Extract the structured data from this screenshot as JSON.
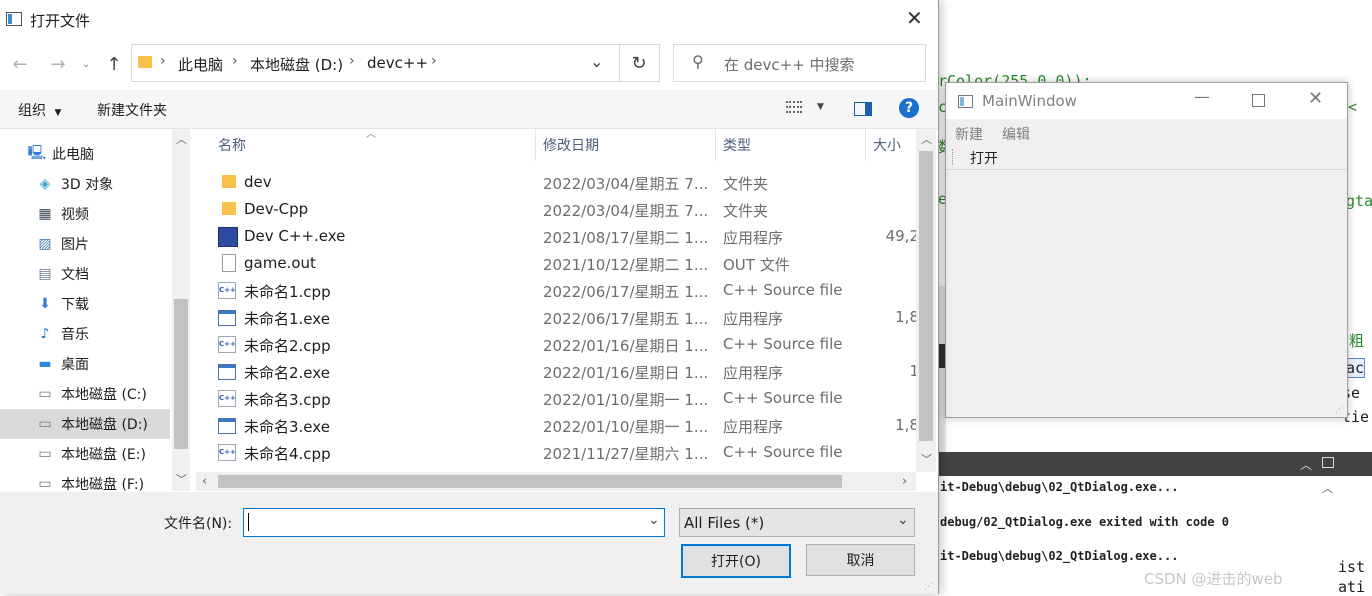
{
  "background": {
    "code_fragments": [
      "rColor(255,0,0));",
      "<",
      "c",
      "数",
      "e",
      "gta",
      "加粗",
      "pac",
      "se",
      "tie",
      "ase",
      "ist",
      "ati"
    ],
    "output_lines": [
      "it-Debug\\debug\\02_QtDialog.exe...",
      "debug/02_QtDialog.exe exited with code 0",
      "it-Debug\\debug\\02_QtDialog.exe..."
    ],
    "watermark": "CSDN @进击的web"
  },
  "main_window": {
    "title": "MainWindow",
    "menu": [
      "新建",
      "编辑"
    ],
    "toolbar_action": "打开"
  },
  "dialog": {
    "title": "打开文件",
    "breadcrumb": [
      "此电脑",
      "本地磁盘 (D:)",
      "devc++"
    ],
    "search_placeholder": "在 devc++ 中搜索",
    "organize_label": "组织",
    "new_folder_label": "新建文件夹",
    "help_glyph": "?",
    "nav_items": [
      {
        "label": "此电脑",
        "icon": "computer-icon"
      },
      {
        "label": "3D 对象",
        "icon": "cube-icon"
      },
      {
        "label": "视频",
        "icon": "video-icon"
      },
      {
        "label": "图片",
        "icon": "picture-icon"
      },
      {
        "label": "文档",
        "icon": "document-icon"
      },
      {
        "label": "下载",
        "icon": "download-icon"
      },
      {
        "label": "音乐",
        "icon": "music-icon"
      },
      {
        "label": "桌面",
        "icon": "desktop-icon"
      },
      {
        "label": "本地磁盘 (C:)",
        "icon": "drive-icon"
      },
      {
        "label": "本地磁盘 (D:)",
        "icon": "drive-icon",
        "selected": true
      },
      {
        "label": "本地磁盘 (E:)",
        "icon": "drive-icon"
      },
      {
        "label": "本地磁盘 (F:)",
        "icon": "drive-icon"
      }
    ],
    "columns": {
      "name": "名称",
      "date": "修改日期",
      "type": "类型",
      "size": "大小"
    },
    "files": [
      {
        "name": "dev",
        "date": "2022/03/04/星期五 7...",
        "type": "文件夹",
        "size": "",
        "icon": "folder-icon"
      },
      {
        "name": "Dev-Cpp",
        "date": "2022/03/04/星期五 7...",
        "type": "文件夹",
        "size": "",
        "icon": "folder-icon"
      },
      {
        "name": "Dev C++.exe",
        "date": "2021/08/17/星期二 1...",
        "type": "应用程序",
        "size": "49,2",
        "icon": "devcpp-app-icon"
      },
      {
        "name": "game.out",
        "date": "2021/10/12/星期二 1...",
        "type": "OUT 文件",
        "size": "",
        "icon": "blank-file-icon"
      },
      {
        "name": "未命名1.cpp",
        "date": "2022/06/17/星期五 1...",
        "type": "C++ Source file",
        "size": "",
        "icon": "cpp-file-icon"
      },
      {
        "name": "未命名1.exe",
        "date": "2022/06/17/星期五 1...",
        "type": "应用程序",
        "size": "1,8",
        "icon": "exe-icon"
      },
      {
        "name": "未命名2.cpp",
        "date": "2022/01/16/星期日 1...",
        "type": "C++ Source file",
        "size": "",
        "icon": "cpp-file-icon"
      },
      {
        "name": "未命名2.exe",
        "date": "2022/01/16/星期日 1...",
        "type": "应用程序",
        "size": "1",
        "icon": "exe-icon"
      },
      {
        "name": "未命名3.cpp",
        "date": "2022/01/10/星期一 1...",
        "type": "C++ Source file",
        "size": "",
        "icon": "cpp-file-icon"
      },
      {
        "name": "未命名3.exe",
        "date": "2022/01/10/星期一 1...",
        "type": "应用程序",
        "size": "1,8",
        "icon": "exe-icon"
      },
      {
        "name": "未命名4.cpp",
        "date": "2021/11/27/星期六 1...",
        "type": "C++ Source file",
        "size": "",
        "icon": "cpp-file-icon"
      }
    ],
    "filename_label": "文件名(N):",
    "filename_value": "",
    "filter_value": "All Files (*)",
    "open_label": "打开(O)",
    "cancel_label": "取消"
  },
  "colors": {
    "accent": "#0078d7",
    "selected_bg": "#cce8ff",
    "folder": "#f8c24a",
    "code_green": "#2a8a2a"
  }
}
